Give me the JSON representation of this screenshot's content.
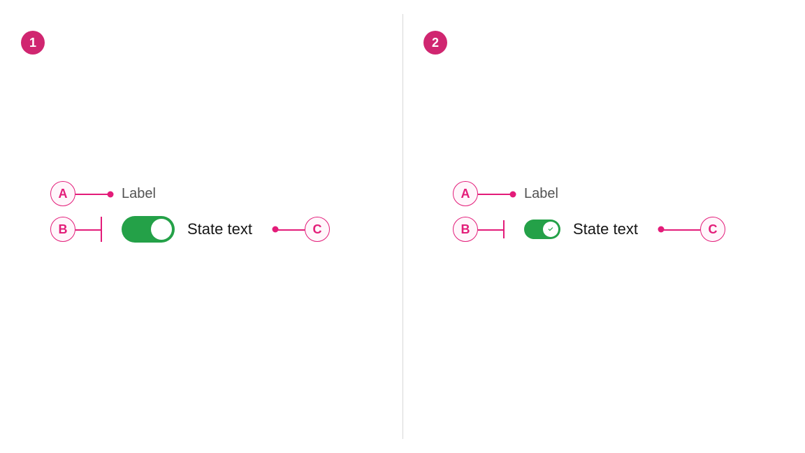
{
  "panels": {
    "left": {
      "number": "1",
      "annotation_a": "A",
      "annotation_b": "B",
      "annotation_c": "C",
      "label_text": "Label",
      "state_text": "State text"
    },
    "right": {
      "number": "2",
      "annotation_a": "A",
      "annotation_b": "B",
      "annotation_c": "C",
      "label_text": "Label",
      "state_text": "State text"
    }
  },
  "colors": {
    "accent": "#e31c79",
    "toggle_on": "#24a148",
    "text_secondary": "#525252",
    "text_primary": "#161616"
  }
}
